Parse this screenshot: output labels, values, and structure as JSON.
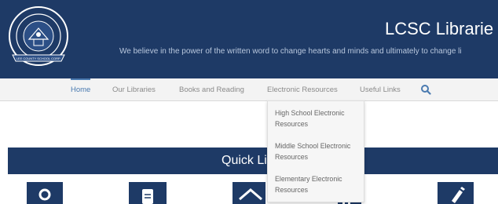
{
  "header": {
    "title": "LCSC Librarie",
    "tagline": "We believe in the power of the written word to change hearts and minds and ultimately to change li",
    "logo_text": "PATHWAY TO EXCELLENCE · LEE COUNTY SCHOOL CORPORATION",
    "logo_icon": "school-seal"
  },
  "nav": {
    "items": [
      {
        "label": "Home",
        "active": true
      },
      {
        "label": "Our Libraries"
      },
      {
        "label": "Books and Reading"
      },
      {
        "label": "Electronic Resources"
      },
      {
        "label": "Useful Links"
      }
    ],
    "search_icon": "search-icon"
  },
  "dropdown": {
    "items": [
      {
        "line1": "High School Electronic",
        "line2": "Resources"
      },
      {
        "line1": "Middle School Electronic",
        "line2": "Resources"
      },
      {
        "line1": "Elementary Electronic",
        "line2": "Resources"
      }
    ]
  },
  "quick_links": {
    "title": "Quick Li",
    "tiles": [
      "search-icon",
      "document-icon",
      "home-icon",
      "grid-icon",
      "pencil-icon"
    ]
  },
  "colors": {
    "header_bg": "#1e3a66",
    "nav_active": "#4a7ab0",
    "nav_text": "#8a8a8a",
    "dropdown_bg": "#f6f6f6"
  }
}
